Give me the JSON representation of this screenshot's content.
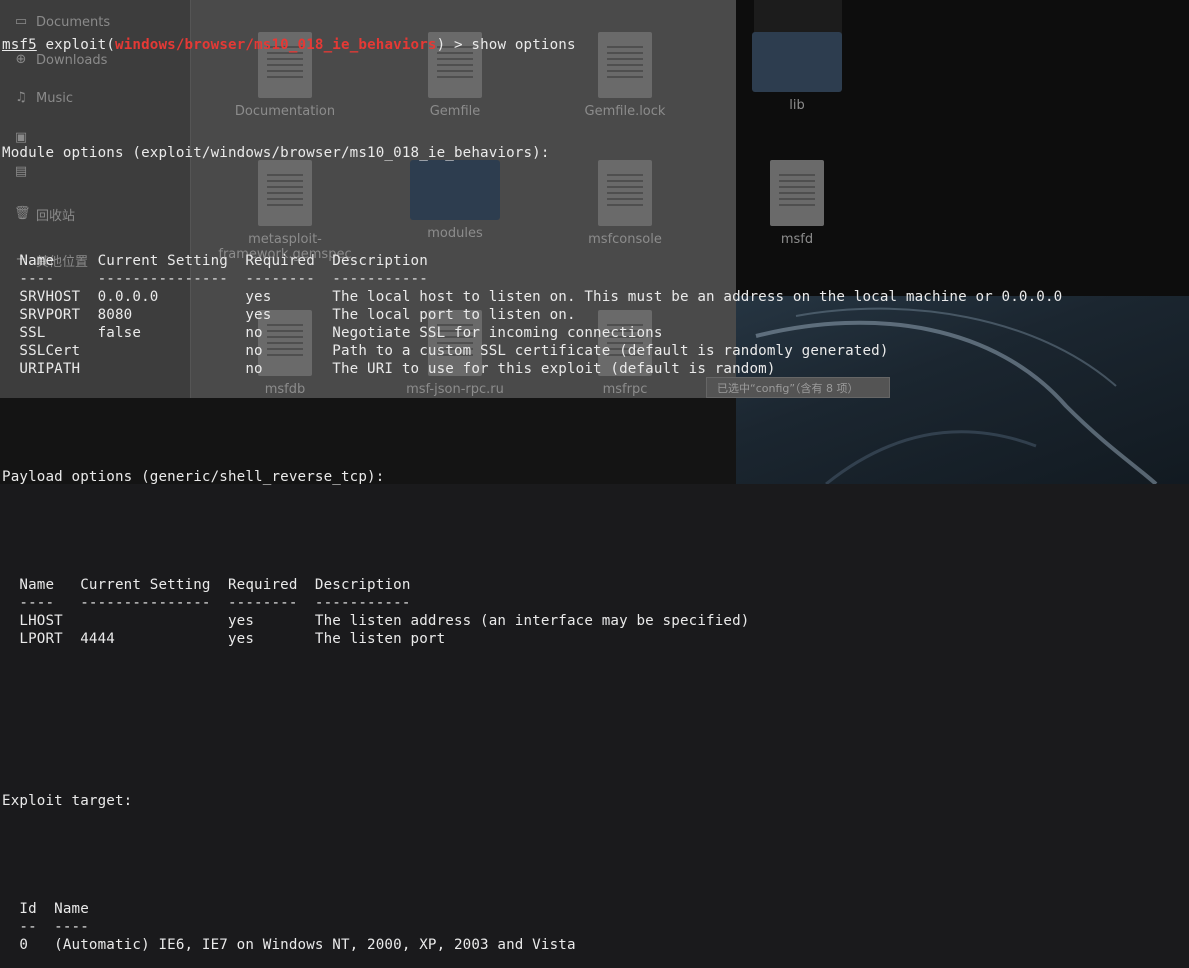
{
  "background": {
    "file_manager": {
      "sidebar_items": [
        {
          "icon": "document-icon",
          "label": "Documents"
        },
        {
          "icon": "download-icon",
          "label": "Downloads"
        },
        {
          "icon": "music-icon",
          "label": "Music"
        },
        {
          "icon": "pictures-icon",
          "label": ""
        },
        {
          "icon": "video-icon",
          "label": ""
        },
        {
          "icon": "trash-icon",
          "label": "回收站"
        },
        {
          "icon": "plus-icon",
          "label": "其他位置"
        }
      ],
      "files": [
        {
          "name": "Documentation",
          "kind": "doc"
        },
        {
          "name": "Gemfile",
          "kind": "doc"
        },
        {
          "name": "Gemfile.lock",
          "kind": "doc"
        },
        {
          "name": "lib",
          "kind": "folder"
        },
        {
          "name": "metasploit-framework.gemspec",
          "kind": "doc"
        },
        {
          "name": "modules",
          "kind": "folder"
        },
        {
          "name": "msfconsole",
          "kind": "doc"
        },
        {
          "name": "msfd",
          "kind": "doc"
        },
        {
          "name": "msfdb",
          "kind": "doc"
        },
        {
          "name": "msf-json-rpc.ru",
          "kind": "doc"
        },
        {
          "name": "msfrpc",
          "kind": "doc"
        }
      ],
      "status": "已选中“config”（含有 8 项）"
    }
  },
  "terminal": {
    "prompt": {
      "program": "msf5",
      "prefix": " exploit(",
      "module": "windows/browser/ms10_018_ie_behaviors",
      "suffix": ") > show options"
    },
    "module_options_title": "Module options (exploit/windows/browser/ms10_018_ie_behaviors):",
    "module_options": {
      "headers": [
        "Name",
        "Current Setting",
        "Required",
        "Description"
      ],
      "underline": [
        "----",
        "---------------",
        "--------",
        "-----------"
      ],
      "rows": [
        [
          "SRVHOST",
          "0.0.0.0",
          "yes",
          "The local host to listen on. This must be an address on the local machine or 0.0.0.0"
        ],
        [
          "SRVPORT",
          "8080",
          "yes",
          "The local port to listen on."
        ],
        [
          "SSL",
          "false",
          "no",
          "Negotiate SSL for incoming connections"
        ],
        [
          "SSLCert",
          "",
          "no",
          "Path to a custom SSL certificate (default is randomly generated)"
        ],
        [
          "URIPATH",
          "",
          "no",
          "The URI to use for this exploit (default is random)"
        ]
      ]
    },
    "payload_options_title": "Payload options (generic/shell_reverse_tcp):",
    "payload_options": {
      "headers": [
        "Name",
        "Current Setting",
        "Required",
        "Description"
      ],
      "underline": [
        "----",
        "---------------",
        "--------",
        "-----------"
      ],
      "rows": [
        [
          "LHOST",
          "",
          "yes",
          "The listen address (an interface may be specified)"
        ],
        [
          "LPORT",
          "4444",
          "yes",
          "The listen port"
        ]
      ]
    },
    "exploit_target_title": "Exploit target:",
    "exploit_target": {
      "headers": [
        "Id",
        "Name"
      ],
      "underline": [
        "--",
        "----"
      ],
      "rows": [
        [
          "0",
          "(Automatic) IE6, IE7 on Windows NT, 2000, XP, 2003 and Vista"
        ]
      ]
    }
  },
  "colors": {
    "terminal_text": "#eaeaea",
    "module_highlight": "#e53935"
  }
}
